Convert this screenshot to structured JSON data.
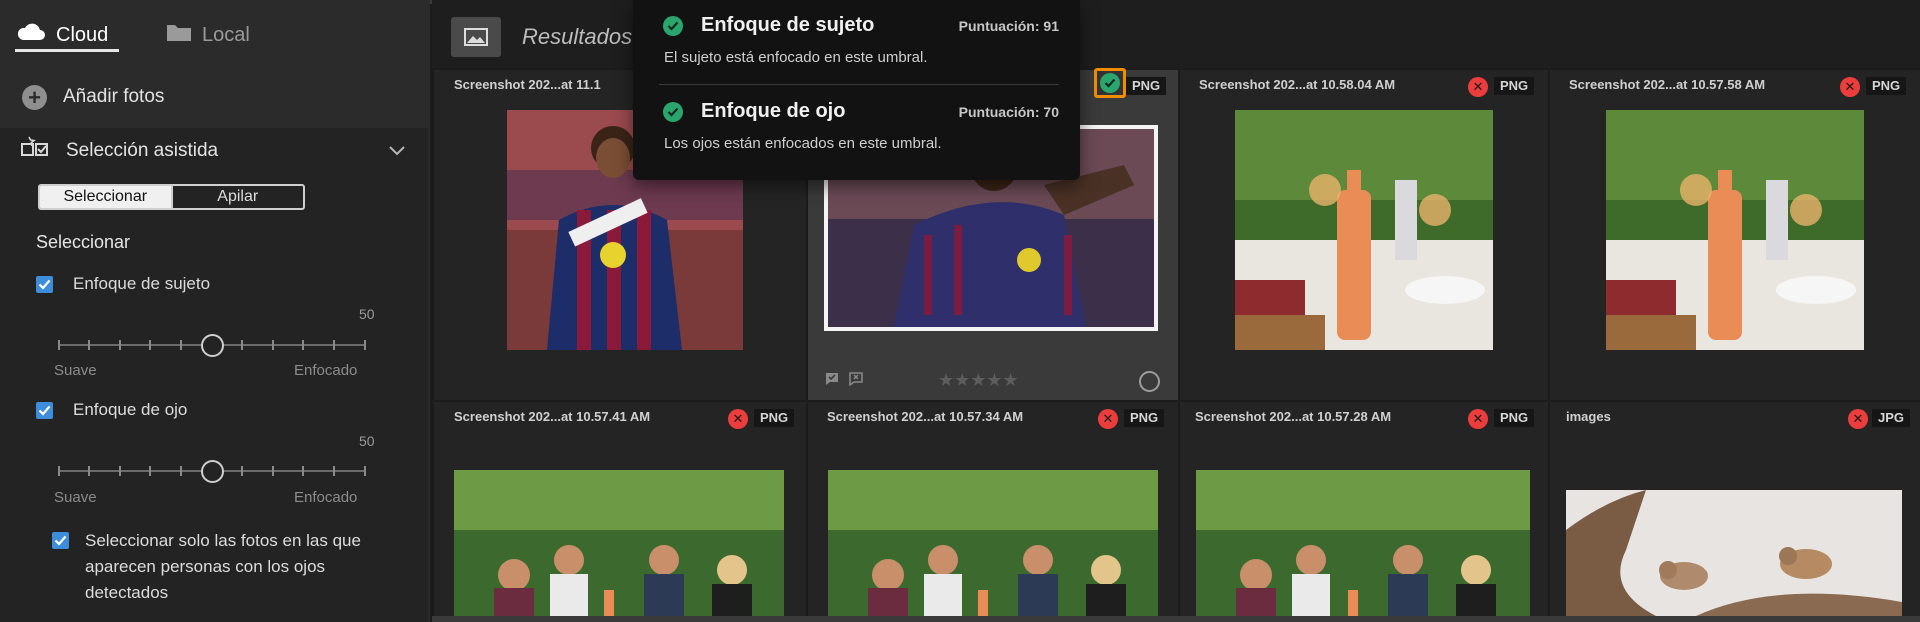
{
  "sidebar": {
    "tabs": [
      {
        "label": "Cloud",
        "icon": "cloud-icon",
        "active": true
      },
      {
        "label": "Local",
        "icon": "folder-icon",
        "active": false
      }
    ],
    "add_photos": "Añadir fotos",
    "assisted": {
      "title": "Selección asistida",
      "segments": [
        "Seleccionar",
        "Apilar"
      ],
      "section": "Seleccionar",
      "subject_focus": {
        "label": "Enfoque de sujeto",
        "checked": true,
        "value": "50",
        "min_label": "Suave",
        "max_label": "Enfocado",
        "level": 0.5
      },
      "eye_focus": {
        "label": "Enfoque de ojo",
        "checked": true,
        "value": "50",
        "min_label": "Suave",
        "max_label": "Enfocado",
        "level": 0.5
      },
      "people_only": {
        "label": "Seleccionar solo las fotos en las que aparecen personas con los ojos detectados",
        "checked": true
      }
    }
  },
  "main": {
    "header": {
      "results": "Resultados",
      "icon": "image-icon"
    },
    "grid": [
      {
        "name": "Screenshot 202...at 11.1",
        "format": "",
        "status": "none"
      },
      {
        "name": "",
        "format": "PNG",
        "status": "accepted",
        "selected": true,
        "rating": "★★★★★"
      },
      {
        "name": "Screenshot 202...at 10.58.04 AM",
        "format": "PNG",
        "status": "rejected"
      },
      {
        "name": "Screenshot 202...at 10.57.58 AM",
        "format": "PNG",
        "status": "rejected"
      },
      {
        "name": "Screenshot 202...at 10.57.41 AM",
        "format": "PNG",
        "status": "rejected"
      },
      {
        "name": "Screenshot 202...at 10.57.34 AM",
        "format": "PNG",
        "status": "rejected"
      },
      {
        "name": "Screenshot 202...at 10.57.28 AM",
        "format": "PNG",
        "status": "rejected"
      },
      {
        "name": "images",
        "format": "JPG",
        "status": "rejected"
      }
    ]
  },
  "tooltip": {
    "items": [
      {
        "title": "Enfoque de sujeto",
        "score": "Puntuación: 91",
        "desc": "El sujeto está enfocado en este umbral."
      },
      {
        "title": "Enfoque de ojo",
        "score": "Puntuación: 70",
        "desc": "Los ojos están enfocados en este umbral."
      }
    ]
  },
  "colors": {
    "accent": "#3d8ddc",
    "reject": "#ec3d3d",
    "accept": "#2aa56e",
    "highlight": "#f08d00"
  }
}
